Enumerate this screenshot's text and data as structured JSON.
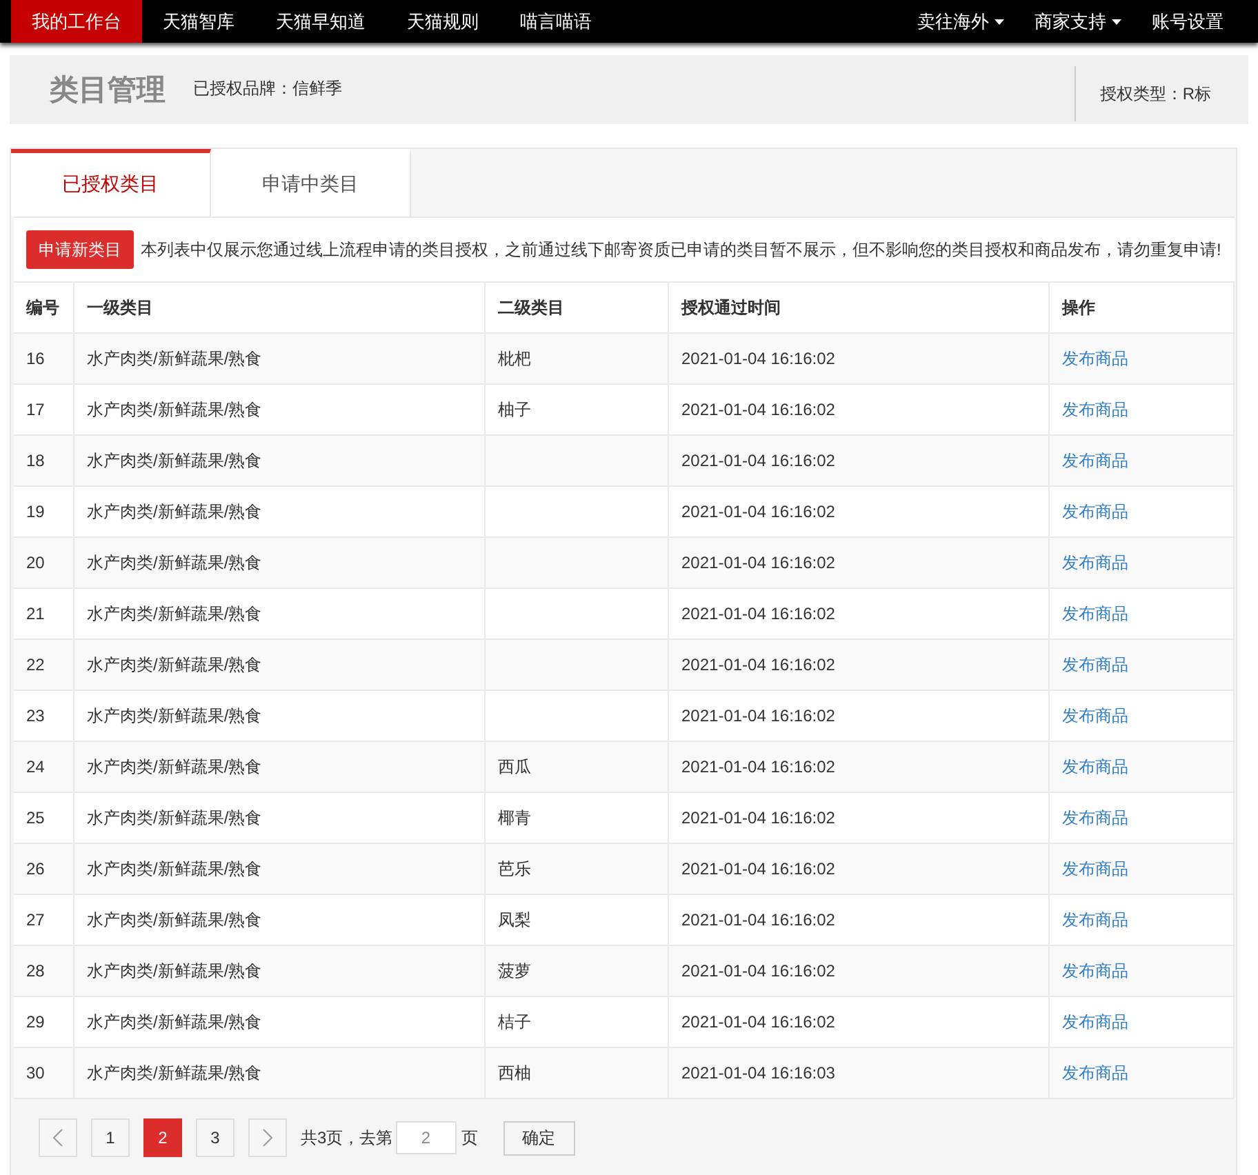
{
  "top_nav": {
    "left": [
      {
        "label": "我的工作台",
        "selected": true
      },
      {
        "label": "天猫智库",
        "selected": false
      },
      {
        "label": "天猫早知道",
        "selected": false
      },
      {
        "label": "天猫规则",
        "selected": false
      },
      {
        "label": "喵言喵语",
        "selected": false
      }
    ],
    "right": [
      {
        "label": "卖往海外",
        "dropdown": true
      },
      {
        "label": "商家支持",
        "dropdown": true
      },
      {
        "label": "账号设置",
        "dropdown": false
      }
    ]
  },
  "header": {
    "title": "类目管理",
    "brand": "已授权品牌：信鲜季",
    "auth_type": "授权类型：R标"
  },
  "tabs": [
    {
      "label": "已授权类目",
      "selected": true
    },
    {
      "label": "申请中类目",
      "selected": false
    }
  ],
  "apply_button": "申请新类目",
  "notice": "本列表中仅展示您通过线上流程申请的类目授权，之前通过线下邮寄资质已申请的类目暂不展示，但不影响您的类目授权和商品发布，请勿重复申请!",
  "table": {
    "columns": [
      "编号",
      "一级类目",
      "二级类目",
      "授权通过时间",
      "操作"
    ],
    "rows": [
      {
        "id": "16",
        "level1": "水产肉类/新鲜蔬果/熟食",
        "level2": "枇杷",
        "time": "2021-01-04 16:16:02",
        "action": "发布商品"
      },
      {
        "id": "17",
        "level1": "水产肉类/新鲜蔬果/熟食",
        "level2": "柚子",
        "time": "2021-01-04 16:16:02",
        "action": "发布商品"
      },
      {
        "id": "18",
        "level1": "水产肉类/新鲜蔬果/熟食",
        "time": "2021-01-04 16:16:02",
        "action": "发布商品"
      },
      {
        "id": "19",
        "level1": "水产肉类/新鲜蔬果/熟食",
        "time": "2021-01-04 16:16:02",
        "action": "发布商品"
      },
      {
        "id": "20",
        "level1": "水产肉类/新鲜蔬果/熟食",
        "time": "2021-01-04 16:16:02",
        "action": "发布商品"
      },
      {
        "id": "21",
        "level1": "水产肉类/新鲜蔬果/熟食",
        "time": "2021-01-04 16:16:02",
        "action": "发布商品"
      },
      {
        "id": "22",
        "level1": "水产肉类/新鲜蔬果/熟食",
        "time": "2021-01-04 16:16:02",
        "action": "发布商品"
      },
      {
        "id": "23",
        "level1": "水产肉类/新鲜蔬果/熟食",
        "time": "2021-01-04 16:16:02",
        "action": "发布商品"
      },
      {
        "id": "24",
        "level1": "水产肉类/新鲜蔬果/熟食",
        "level2": "西瓜",
        "time": "2021-01-04 16:16:02",
        "action": "发布商品"
      },
      {
        "id": "25",
        "level1": "水产肉类/新鲜蔬果/熟食",
        "level2": "椰青",
        "time": "2021-01-04 16:16:02",
        "action": "发布商品"
      },
      {
        "id": "26",
        "level1": "水产肉类/新鲜蔬果/熟食",
        "level2": "芭乐",
        "time": "2021-01-04 16:16:02",
        "action": "发布商品"
      },
      {
        "id": "27",
        "level1": "水产肉类/新鲜蔬果/熟食",
        "level2": "凤梨",
        "time": "2021-01-04 16:16:02",
        "action": "发布商品"
      },
      {
        "id": "28",
        "level1": "水产肉类/新鲜蔬果/熟食",
        "level2": "菠萝",
        "time": "2021-01-04 16:16:02",
        "action": "发布商品"
      },
      {
        "id": "29",
        "level1": "水产肉类/新鲜蔬果/熟食",
        "level2": "桔子",
        "time": "2021-01-04 16:16:02",
        "action": "发布商品"
      },
      {
        "id": "30",
        "level1": "水产肉类/新鲜蔬果/熟食",
        "level2": "西柚",
        "time": "2021-01-04 16:16:03",
        "action": "发布商品"
      }
    ]
  },
  "pagination": {
    "pages": [
      {
        "label": "1",
        "selected": false
      },
      {
        "label": "2",
        "selected": true
      },
      {
        "label": "3",
        "selected": false
      }
    ],
    "total": "共3页，去第",
    "goto_value": "2",
    "page_suffix": "页",
    "confirm": "确定"
  }
}
